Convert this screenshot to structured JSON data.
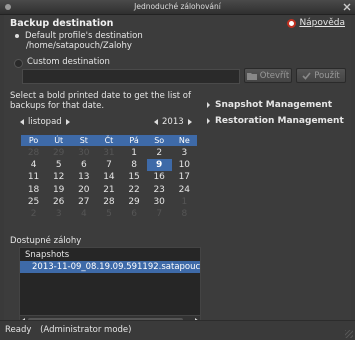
{
  "window": {
    "title": "Jednoduché zálohování"
  },
  "header": {
    "title": "Backup destination",
    "help_label": "Nápověda"
  },
  "destination": {
    "default_label": "Default profile's destination",
    "default_path": "/home/satapouch/Zalohy",
    "custom_label": "Custom destination",
    "custom_value": "",
    "open_label": "Otevřít",
    "use_label": "Použít"
  },
  "calendar": {
    "instruction": "Select a bold printed date to get the list of backups for that date.",
    "month": "listopad",
    "year": "2013",
    "weekdays": [
      "Po",
      "Út",
      "St",
      "Čt",
      "Pá",
      "So",
      "Ne"
    ],
    "weeks": [
      [
        28,
        29,
        30,
        31,
        1,
        2,
        3
      ],
      [
        4,
        5,
        6,
        7,
        8,
        9,
        10
      ],
      [
        11,
        12,
        13,
        14,
        15,
        16,
        17
      ],
      [
        18,
        19,
        20,
        21,
        22,
        23,
        24
      ],
      [
        25,
        26,
        27,
        28,
        29,
        30,
        1
      ],
      [
        2,
        3,
        4,
        5,
        6,
        7,
        8
      ]
    ],
    "selected_day": 9
  },
  "side_panel": {
    "items": [
      {
        "label": "Snapshot Management"
      },
      {
        "label": "Restoration Management"
      }
    ]
  },
  "snapshots": {
    "section_label": "Dostupné zálohy",
    "column_header": "Snapshots",
    "items": [
      "2013-11-09_08.19.09.591192.satapouch"
    ]
  },
  "statusbar": {
    "status": "Ready",
    "mode": "(Administrator mode)"
  },
  "colors": {
    "accent": "#3e6aa8",
    "background": "#3c3c3c",
    "help_icon": "#c03020"
  }
}
